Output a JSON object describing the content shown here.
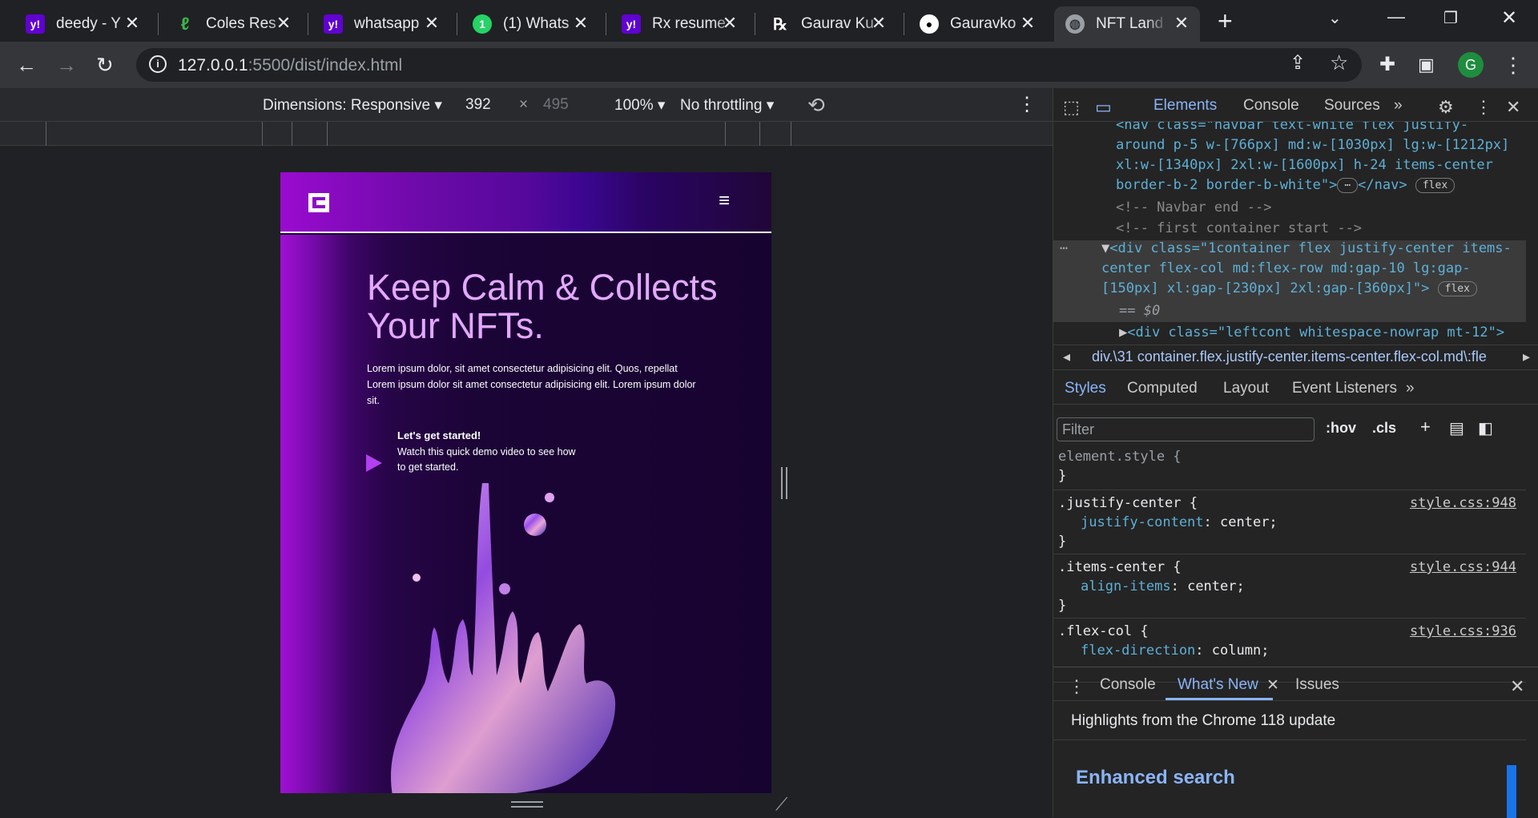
{
  "tabs": [
    {
      "title": "deedy - Y",
      "icon": "yahoo-icon"
    },
    {
      "title": "Coles Res",
      "icon": "coles-leaf-icon"
    },
    {
      "title": "whatsapp",
      "icon": "yahoo-icon"
    },
    {
      "title": "(1) Whats",
      "icon": "whatsapp-icon"
    },
    {
      "title": "Rx resume",
      "icon": "yahoo-icon"
    },
    {
      "title": "Gaurav Ku",
      "icon": "rx-icon"
    },
    {
      "title": "Gauravko",
      "icon": "github-icon"
    },
    {
      "title": "NFT Land",
      "icon": "globe-icon",
      "active": true
    }
  ],
  "address": {
    "host": "127.0.0.1",
    "path": ":5500/dist/index.html"
  },
  "profile_initial": "G",
  "device_toolbar": {
    "dimensions_label": "Dimensions: Responsive",
    "width": "392",
    "times": "×",
    "height": "495",
    "zoom": "100%",
    "throttling": "No throttling"
  },
  "page": {
    "logo": "G",
    "hero_title": "Keep Calm & Collects Your NFTs.",
    "hero_text": "Lorem ipsum dolor, sit amet consectetur adipisicing elit. Quos, repellat Lorem ipsum dolor sit amet consectetur adipisicing elit. Lorem ipsum dolor sit.",
    "cta_title": "Let's get started!",
    "cta_text": "Watch this quick demo video to see how to get started."
  },
  "devtools": {
    "tabs": [
      "Elements",
      "Console",
      "Sources"
    ],
    "elements": {
      "nav_open": "<nav class=\"navbar text-white flex justify-around p-5 w-[766px] md:w-[1030px] lg:w-[1212px] xl:w-[1340px] 2xl:w-[1600px] h-24 items-center border-b-2 border-b-white\">",
      "nav_close": "</nav>",
      "comment1": "<!-- Navbar end -->",
      "comment2": "<!-- first container start -->",
      "div_open": "<div class=\"1container flex justify-center items-center flex-col md:flex-row md:gap-10 lg:gap-[150px] xl:gap-[230px] 2xl:gap-[360px]\">",
      "eq": "== $0",
      "child": "<div class=\"leftcont whitespace-nowrap mt-12\">",
      "badge": "flex"
    },
    "breadcrumb": "div.\\31 container.flex.justify-center.items-center.flex-col.md\\:fle",
    "style_tabs": [
      "Styles",
      "Computed",
      "Layout",
      "Event Listeners"
    ],
    "filter_placeholder": "Filter",
    "hov": ":hov",
    "cls": ".cls",
    "rules": [
      {
        "selector": "element.style {",
        "prop": "",
        "value": "",
        "file": ""
      },
      {
        "selector": ".justify-center {",
        "prop": "justify-content",
        "value": "center;",
        "file": "style.css:948"
      },
      {
        "selector": ".items-center {",
        "prop": "align-items",
        "value": "center;",
        "file": "style.css:944"
      },
      {
        "selector": ".flex-col {",
        "prop": "flex-direction",
        "value": "column;",
        "file": "style.css:936"
      }
    ],
    "drawer_tabs": [
      "Console",
      "What's New",
      "Issues"
    ],
    "highlights": "Highlights from the Chrome 118 update",
    "enhanced": "Enhanced search"
  }
}
